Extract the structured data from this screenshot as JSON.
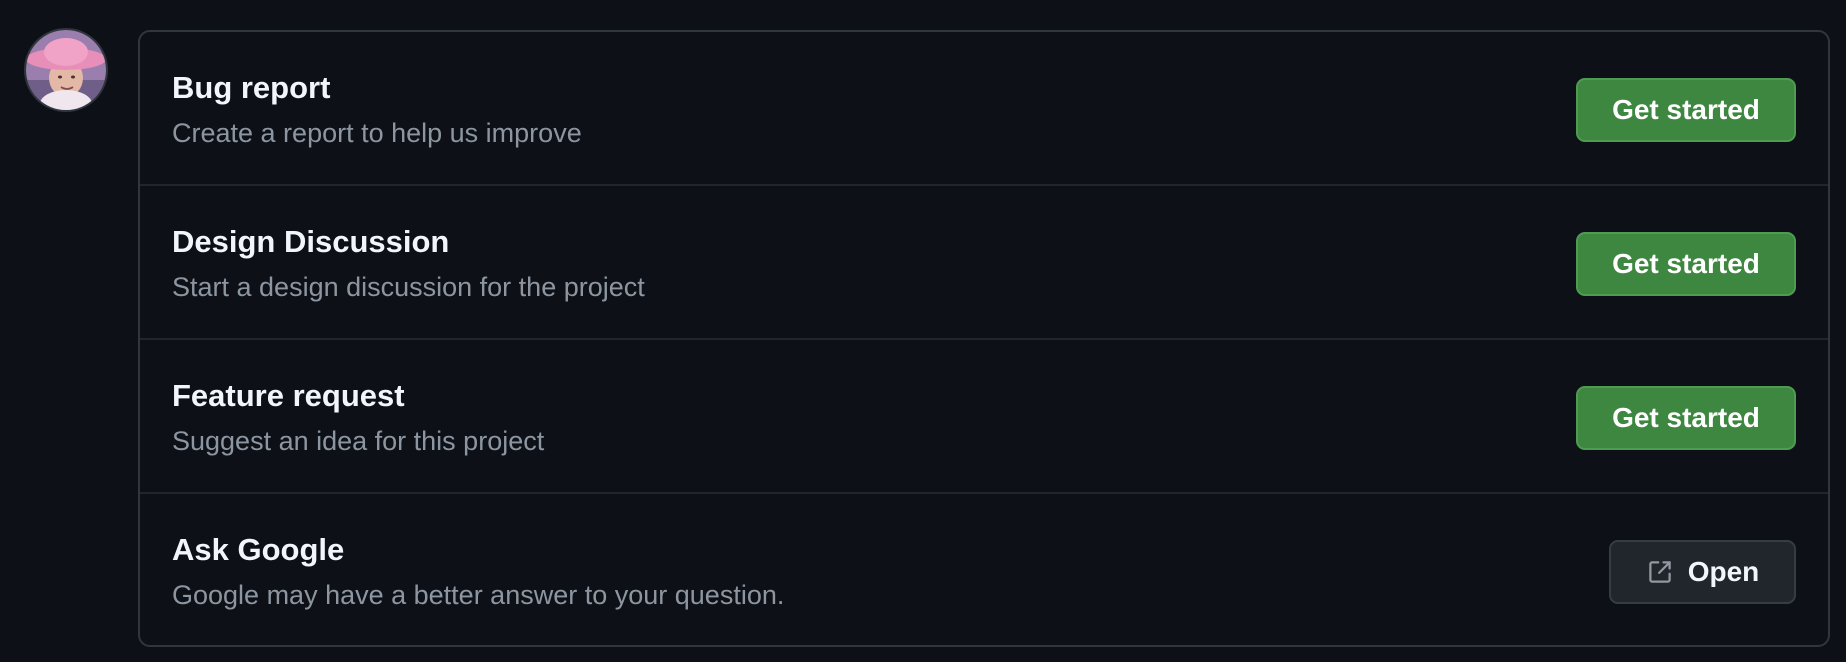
{
  "avatar": {
    "icon": "user-avatar"
  },
  "options": [
    {
      "title": "Bug report",
      "description": "Create a report to help us improve",
      "button_label": "Get started"
    },
    {
      "title": "Design Discussion",
      "description": "Start a design discussion for the project",
      "button_label": "Get started"
    },
    {
      "title": "Feature request",
      "description": "Suggest an idea for this project",
      "button_label": "Get started"
    },
    {
      "title": "Ask Google",
      "description": "Google may have a better answer to your question.",
      "button_label": "Open",
      "button_icon": "link-external-icon"
    }
  ],
  "colors": {
    "background": "#0d1117",
    "primary_button": "#3e8740",
    "border": "#30363d",
    "title_text": "#f0f6fc",
    "muted_text": "#8d96a0"
  }
}
